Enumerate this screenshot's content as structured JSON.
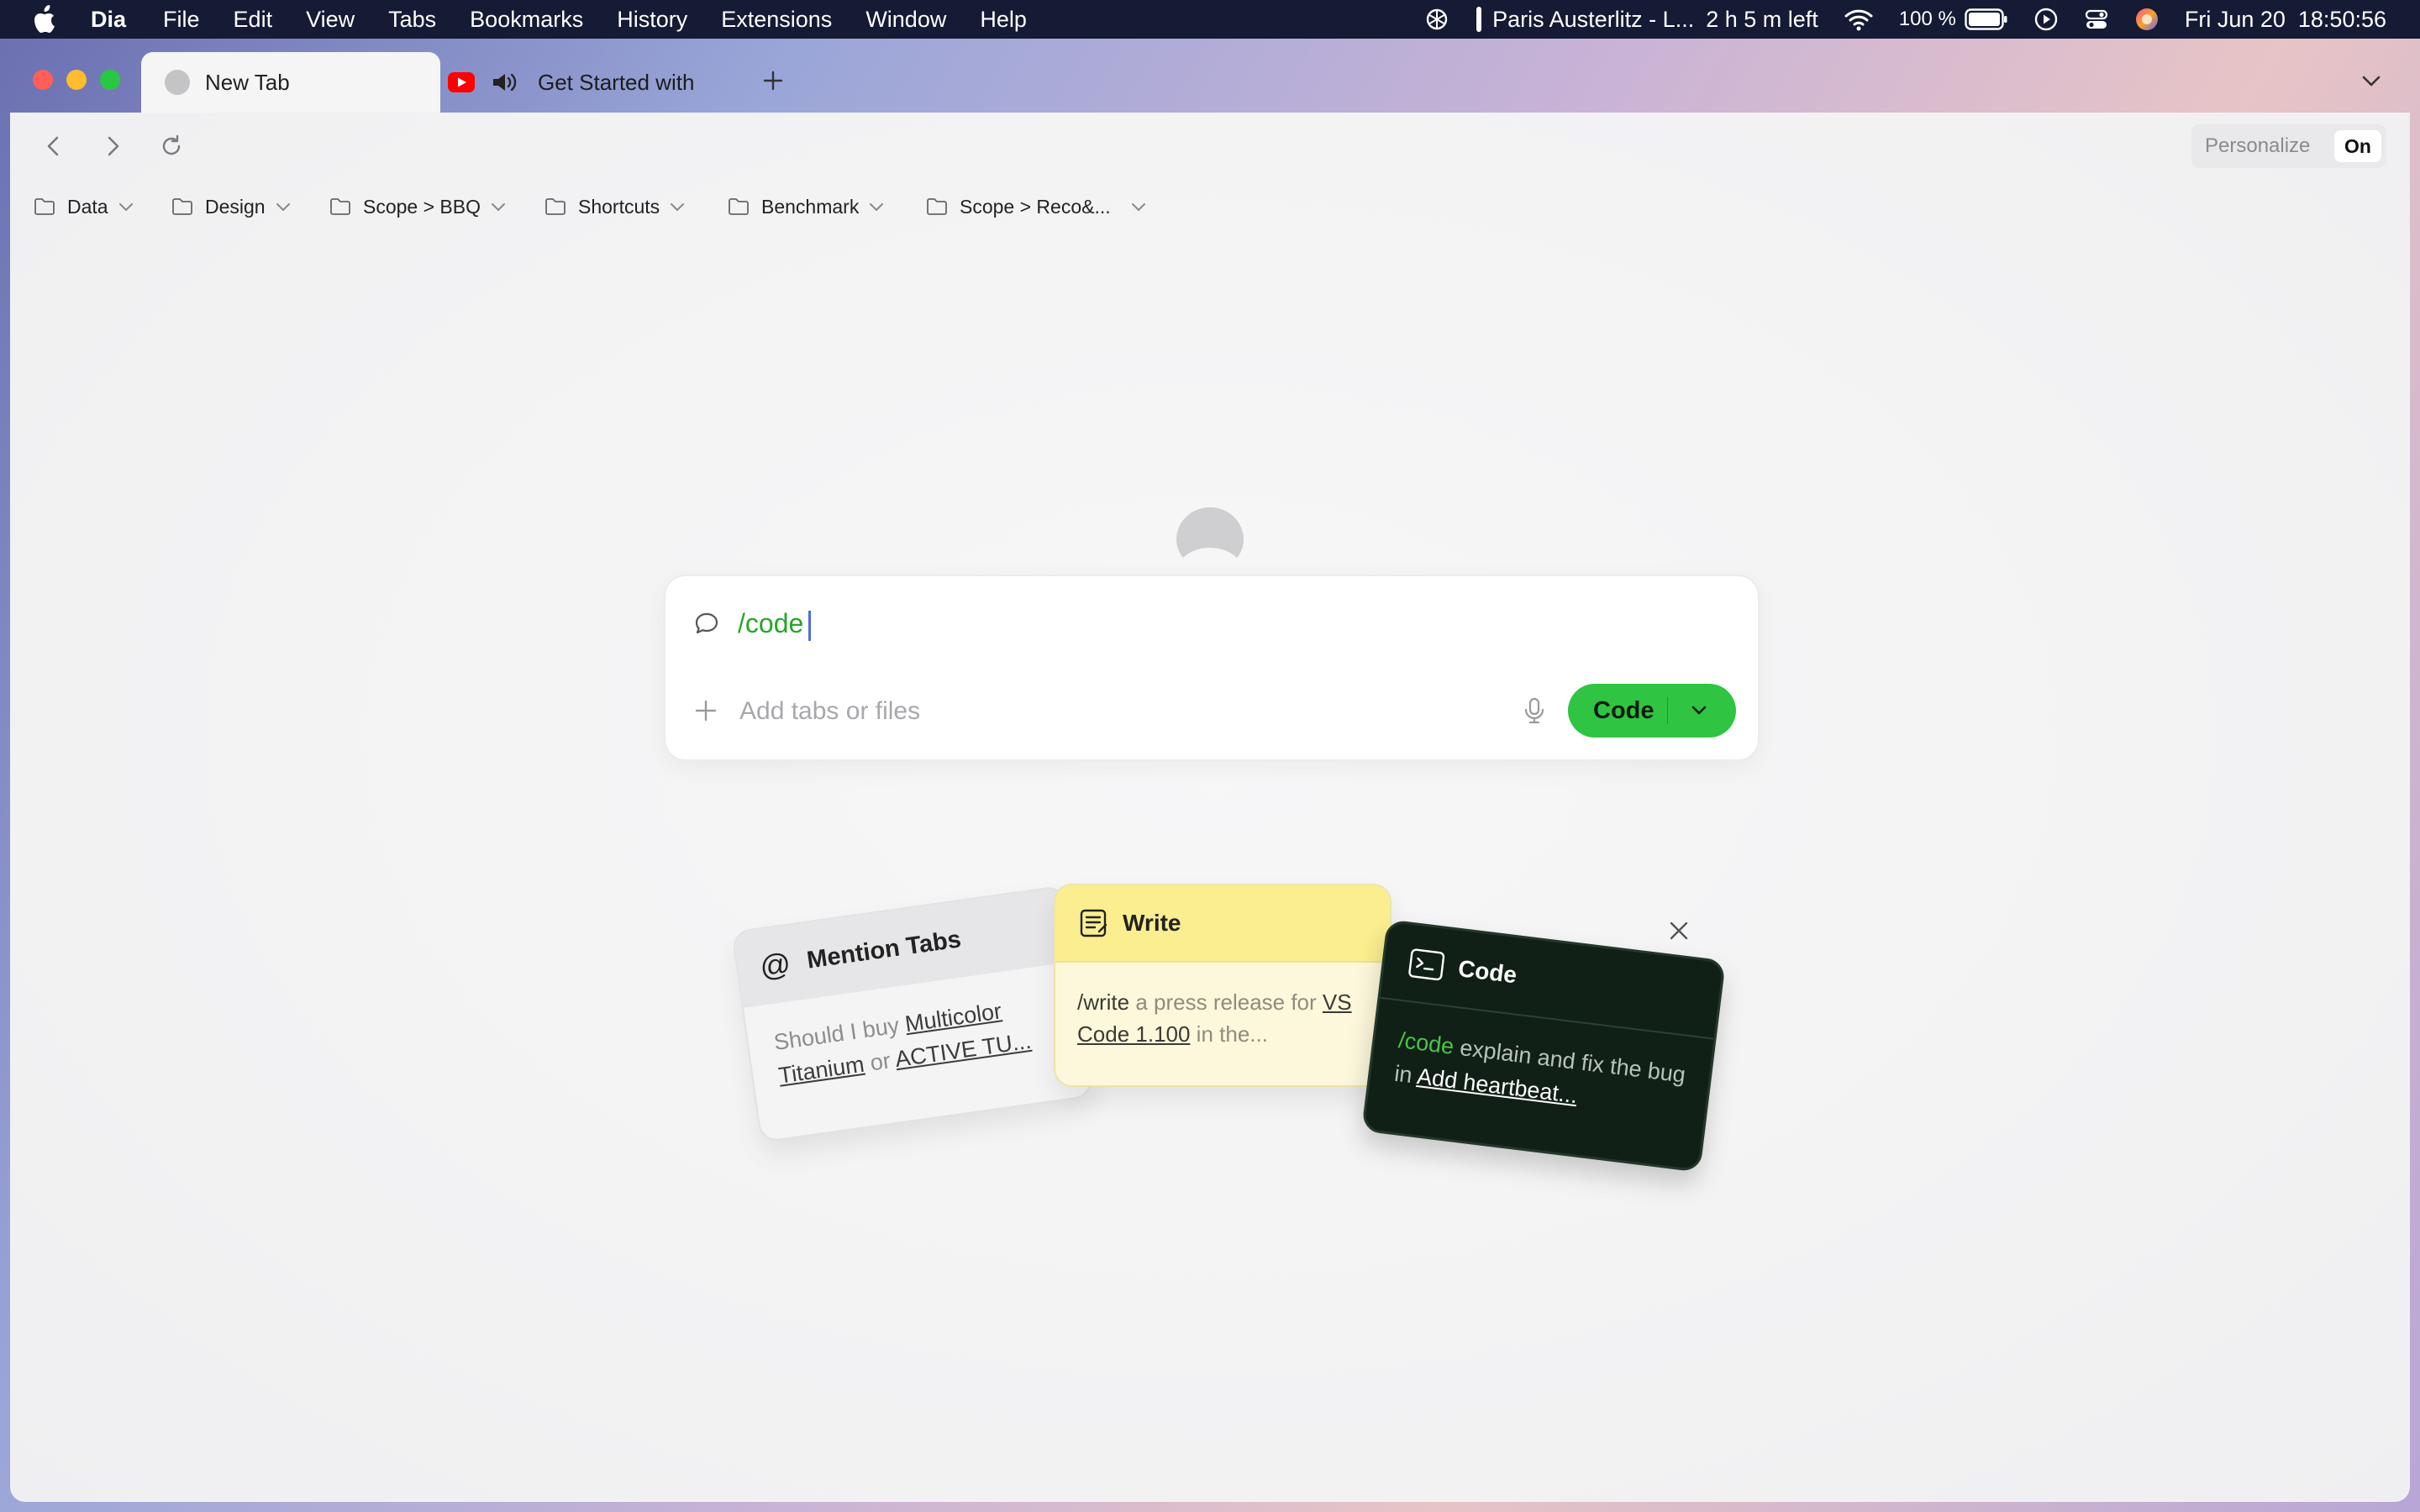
{
  "menubar": {
    "app_name": "Dia",
    "menus": [
      "File",
      "Edit",
      "View",
      "Tabs",
      "Bookmarks",
      "History",
      "Extensions",
      "Window",
      "Help"
    ],
    "now_playing": "Paris Austerlitz - L...",
    "time_left": "2 h 5 m left",
    "battery": "100 %",
    "datetime": "Fri Jun 20  18:50:56"
  },
  "tabs": {
    "active_title": "New Tab",
    "second_title": "Get Started with ",
    "youtube_color": "#ff0000"
  },
  "toolbar": {
    "personalize_label": "Personalize",
    "personalize_state": "On"
  },
  "bookmarks": [
    "Data",
    "Design",
    "Scope > BBQ",
    "Shortcuts",
    "Benchmark",
    "Scope > Reco&..."
  ],
  "composer": {
    "query": "/code",
    "add_placeholder": "Add tabs or files",
    "mode_label": "Code",
    "accent": "#2fc542"
  },
  "cards": {
    "mention": {
      "icon": "@",
      "title": "Mention Tabs",
      "text_1": "Should I buy ",
      "link_1": "Multicolor Titanium",
      "text_2": " or ",
      "link_2": "ACTIVE TU..."
    },
    "write": {
      "title": "Write",
      "cmd": "/write",
      "text_1": " a press release for ",
      "link_1": "VS Code 1.100",
      "text_2": " in the..."
    },
    "code": {
      "title": "Code",
      "cmd": "/code",
      "text_1": " explain and fix the bug in ",
      "link_1": "Add heartbeat..."
    }
  }
}
